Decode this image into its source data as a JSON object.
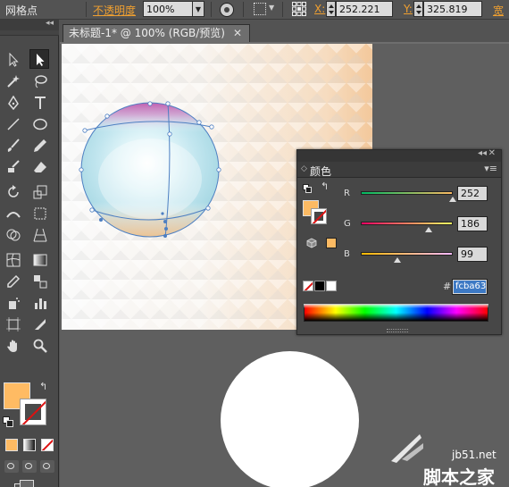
{
  "control_bar": {
    "tool_name": "网格点",
    "opacity_label": "不透明度",
    "opacity_value": "100%",
    "x_label": "X:",
    "x_value": "252.221",
    "y_label": "Y:",
    "y_value": "325.819",
    "width_label": "宽"
  },
  "document": {
    "tab_title": "未标题-1* @ 100% (RGB/预览)",
    "close_glyph": "✕"
  },
  "color_panel": {
    "title": "颜色",
    "collapse_glyph": "◂◂",
    "close_glyph": "✕",
    "menu_glyph": "▾≡",
    "r_label": "R",
    "g_label": "G",
    "b_label": "B",
    "r_value": "252",
    "g_value": "186",
    "b_value": "99",
    "r_fraction": 0.988,
    "g_fraction": 0.729,
    "b_fraction": 0.388,
    "hash_label": "#",
    "hex_value": "fcba63",
    "fill_color": "#fcba63"
  },
  "tools": {
    "fill_color": "#ffbb63",
    "collapse_glyph": "◂◂"
  },
  "watermark": {
    "site": "jb51.net",
    "brand": "脚本之家"
  }
}
